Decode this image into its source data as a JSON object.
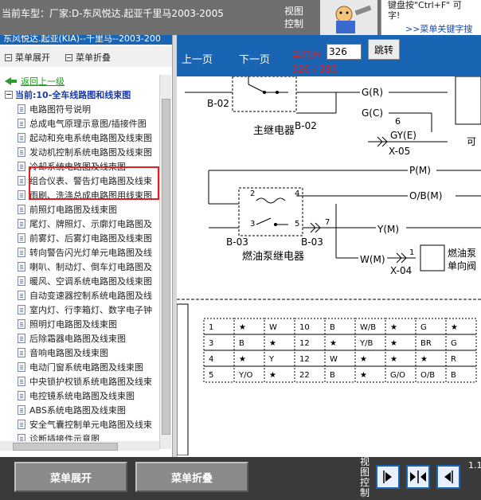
{
  "header": {
    "car_title": "当前车型：厂家:D-东风悦达.起亚千里马2003-2005",
    "view_control": "视图控制",
    "hint_line1": "键盘按\"Ctrl+F\" 可",
    "hint_line2": "字!",
    "hint_link": ">>菜单关键字搜"
  },
  "left_panel": {
    "header_text": "东风悦达.起亚(KIA)--千里马--2003-200",
    "menu_expand": "菜单展开",
    "menu_collapse": "菜单折叠",
    "back_label": "返回上一级",
    "current_label": "当前:10-全车线路图和线束图",
    "items": [
      {
        "label": "电路图符号说明"
      },
      {
        "label": "总成电气原理示意图/插接件图"
      },
      {
        "label": "起动和充电系统电路图及线束图"
      },
      {
        "label": "发动机控制系统电路图及线束图"
      },
      {
        "label": "冷却系统电路图及线束图"
      },
      {
        "label": "组合仪表、警告灯电路图及线束"
      },
      {
        "label": "雨刷、洗涤总成电路图用线束图"
      },
      {
        "label": "前照灯电路图及线束图"
      },
      {
        "label": "尾灯、牌照灯、示廓灯电路图及"
      },
      {
        "label": "前雾灯、后雾灯电路图及线束图"
      },
      {
        "label": "转向警告闪光灯单元电路图及线"
      },
      {
        "label": "喇叭、制动灯、倒车灯电路图及"
      },
      {
        "label": "暖风、空调系统电路图及线束图"
      },
      {
        "label": "自动变速器控制系统电路图及线"
      },
      {
        "label": "室内灯、行李箱灯、数字电子钟"
      },
      {
        "label": "照明灯电路图及线束图"
      },
      {
        "label": "后除霜器电路图及线束图"
      },
      {
        "label": "音响电路图及线束图"
      },
      {
        "label": "电动门窗系统电路图及线束图"
      },
      {
        "label": "中央锁护权锁系统电路图及线束"
      },
      {
        "label": "电控镜系统电路图及线束图"
      },
      {
        "label": "ABS系统电路图及线束图"
      },
      {
        "label": "安全气囊控制单元电路图及线束"
      },
      {
        "label": "诊断插接件示意图"
      }
    ]
  },
  "viewer": {
    "prev_page": "上一页",
    "next_page": "下一页",
    "current_label": "当前为",
    "page_input_value": "326",
    "jump_button": "跳转",
    "page_count": "326 / 385",
    "diagram": {
      "labels": {
        "b02_left": "B-02",
        "b02_right": "B-02",
        "main_relay": "主继电器",
        "gr1": "G(R)",
        "gr2": "G(C)",
        "x05": "X-05",
        "gye": "GY(E)",
        "pm": "P(M)",
        "obm": "O/B(M)",
        "ym": "Y(M)",
        "wm": "W(M)",
        "x04": "X-04",
        "b03_left": "B-03",
        "b03_right": "B-03",
        "fuel_relay": "燃油泵继电器",
        "fuel_pump_1": "燃油泵",
        "fuel_pump_2": "单向阀",
        "pin2": "2",
        "pin3": "3",
        "pin4": "4",
        "pin5": "5",
        "pin6": "6",
        "pin7": "7",
        "pin1": "1"
      },
      "connector_cells": [
        [
          "1",
          "★",
          "W",
          "10",
          "B",
          "W/B",
          "★",
          "G",
          "★"
        ],
        [
          "3",
          "B",
          "★",
          "12",
          "★",
          "Y/B",
          "★",
          "BR",
          "G"
        ],
        [
          "4",
          "★",
          "Y",
          "12",
          "W",
          "★",
          "★",
          "★",
          "R"
        ],
        [
          "5",
          "Y/O",
          "★",
          "22",
          "B",
          "★",
          "G/O",
          "O/B",
          "B"
        ]
      ]
    }
  },
  "bottom": {
    "expand_button": "菜单展开",
    "collapse_button": "菜单折叠",
    "view_control": "视图控制",
    "corner_num": "1.1"
  },
  "colors": {
    "blue_toolbar": "#1a64b4",
    "red_highlight": "#e02020",
    "dark_bottom": "#3a3a3a"
  }
}
